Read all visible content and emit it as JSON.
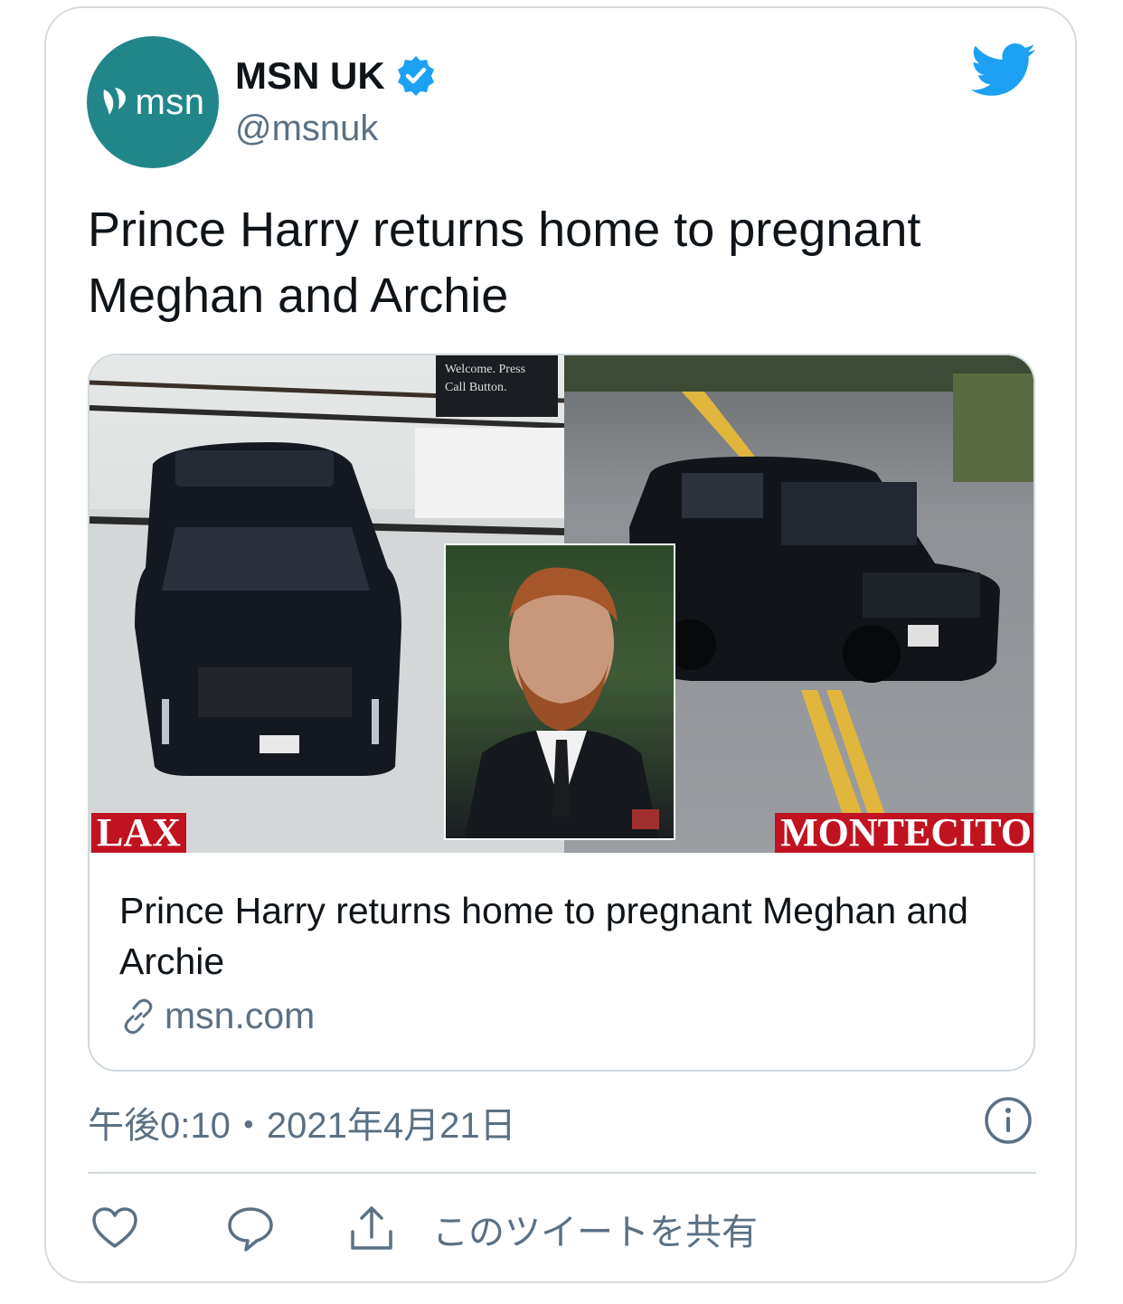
{
  "account": {
    "name": "MSN UK",
    "handle": "@msnuk",
    "avatar_text": "msn",
    "avatar_color": "#21868a",
    "verified": true
  },
  "tweet": {
    "text": "Prince Harry returns home to pregnant Meghan and Archie"
  },
  "link_card": {
    "image_labels": {
      "left": "LAX",
      "right": "MONTECITO",
      "sign": "Welcome. Press Call Button."
    },
    "title": "Prince Harry returns home to pregnant Meghan and Archie",
    "domain": "msn.com"
  },
  "meta": {
    "timestamp": "午後0:10・2021年4月21日"
  },
  "actions": {
    "like_icon": "heart-icon",
    "reply_icon": "reply-icon",
    "share_icon": "share-icon",
    "share_label": "このツイートを共有"
  },
  "colors": {
    "twitter_blue": "#1da1f2",
    "secondary_text": "#5b7083",
    "label_red": "#c1121f"
  }
}
